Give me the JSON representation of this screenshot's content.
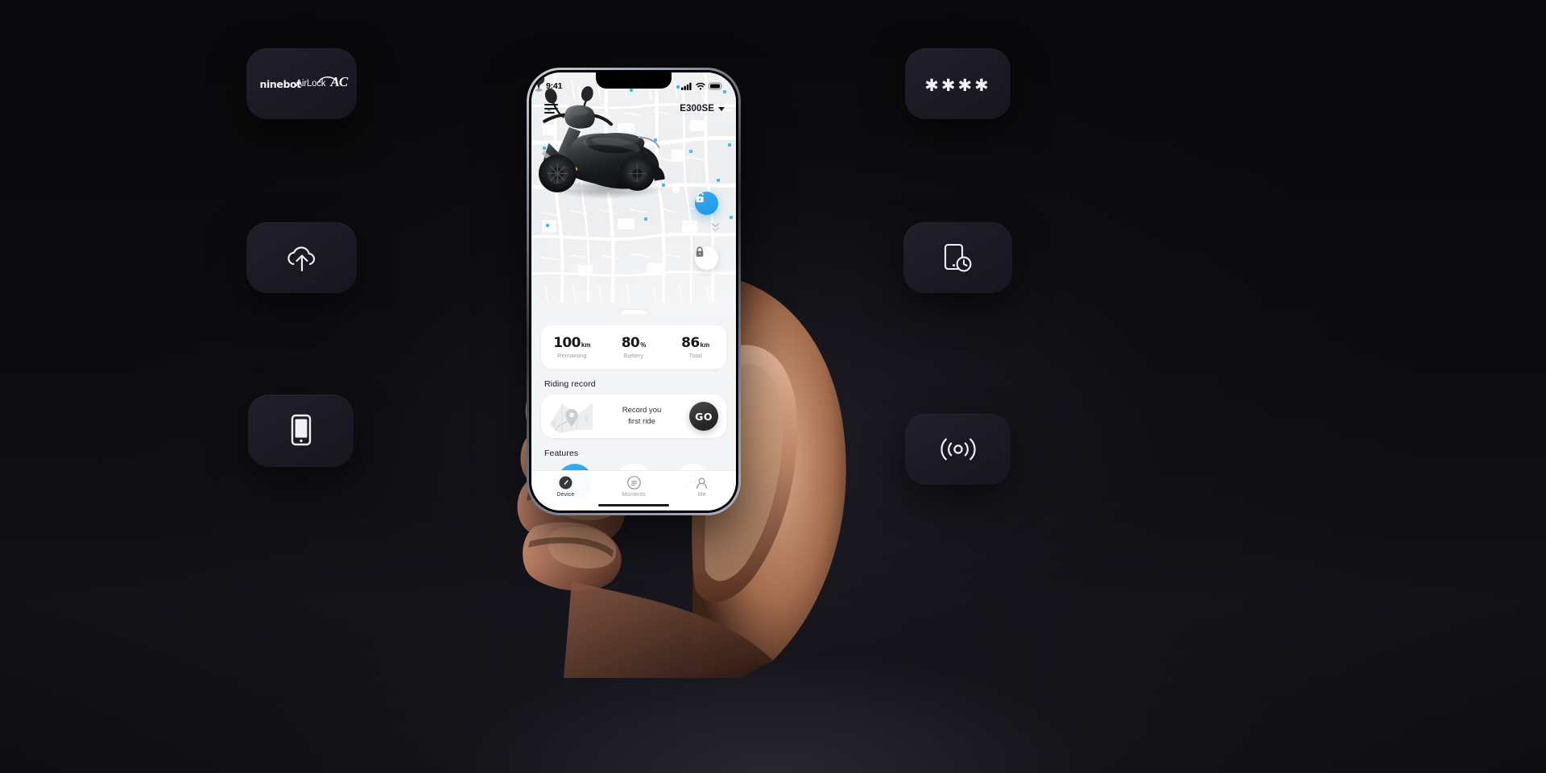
{
  "scene": {
    "background_color": "#0a0a0c",
    "badge_color": "#1e1c28",
    "accent_color": "#1f96e8"
  },
  "badges": [
    {
      "id": "logo",
      "name": "ninebot-airlock-ac-logo",
      "icon": "wordmark-logo",
      "text_primary": "ninebot",
      "text_secondary": "AirLock",
      "text_mark": "AC"
    },
    {
      "id": "password",
      "name": "password-badge",
      "icon": "asterisk-password",
      "value": "✱✱✱✱"
    },
    {
      "id": "cloud",
      "name": "cloud-upload-badge",
      "icon": "cloud-upload-icon"
    },
    {
      "id": "phonetimer",
      "name": "phone-timer-badge",
      "icon": "phone-clock-icon"
    },
    {
      "id": "phone",
      "name": "smartphone-badge",
      "icon": "smartphone-icon"
    },
    {
      "id": "rf",
      "name": "rf-signal-badge",
      "icon": "broadcast-signal-icon"
    }
  ],
  "phone": {
    "status_bar": {
      "time": "9:41",
      "signal": "signal-icon",
      "wifi": "wifi-icon",
      "battery": "battery-icon"
    },
    "map": {
      "menu_label": "menu",
      "model": "E300SE",
      "caret": "chevron-down-icon",
      "unlock_button": "unlock-icon",
      "lock_button": "lock-icon",
      "scroll_hint": "double-chevron-down-icon",
      "expand_handle": "triangle-up-icon"
    },
    "stats": [
      {
        "value": "100",
        "unit": "km",
        "label": "Remaining"
      },
      {
        "value": "80",
        "unit": "%",
        "label": "Battery"
      },
      {
        "value": "86",
        "unit": "km",
        "label": "Total"
      }
    ],
    "riding_record": {
      "title": "Riding record",
      "message_line1": "Record you",
      "message_line2": "first ride",
      "cta": "GO"
    },
    "features": {
      "title": "Features"
    },
    "tabs": [
      {
        "label": "Device",
        "icon": "speedometer-icon",
        "active": true
      },
      {
        "label": "Moments",
        "icon": "list-circle-icon",
        "active": false
      },
      {
        "label": "Me",
        "icon": "person-icon",
        "active": false
      }
    ]
  }
}
